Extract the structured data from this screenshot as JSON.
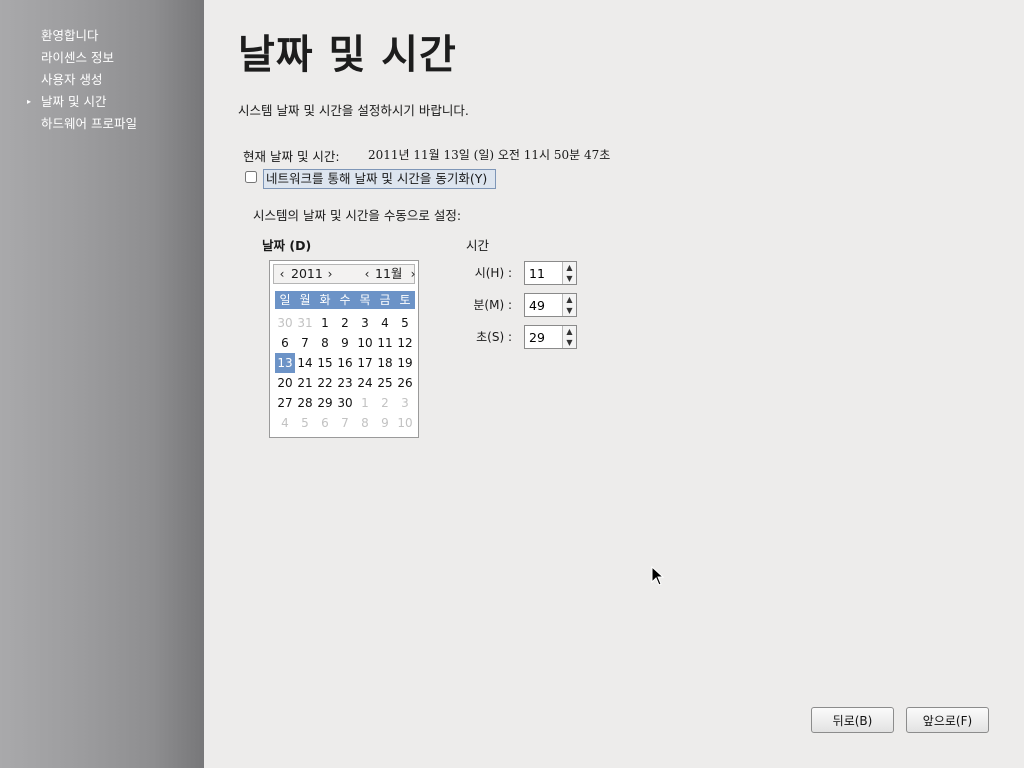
{
  "sidebar": {
    "items": [
      {
        "label": "환영합니다",
        "active": false
      },
      {
        "label": "라이센스 정보",
        "active": false
      },
      {
        "label": "사용자 생성",
        "active": false
      },
      {
        "label": "날짜 및 시간",
        "active": true
      },
      {
        "label": "하드웨어 프로파일",
        "active": false
      }
    ],
    "active_marker": "▸"
  },
  "main": {
    "title": "날짜 및 시간",
    "description": "시스템 날짜 및 시간을 설정하시기 바랍니다.",
    "current_label": "현재 날짜 및 시간:",
    "current_value": "2011년 11월 13일 (일) 오전 11시 50분 47초",
    "sync_label": "네트워크를 통해 날짜 및 시간을 동기화(Y)",
    "sync_checked": false,
    "manual_label": "시스템의 날짜 및 시간을 수동으로 설정:",
    "date_heading": "날짜 (D)",
    "time_heading": "시간"
  },
  "calendar": {
    "year": "2011",
    "month": "11월",
    "prev_glyph": "‹",
    "next_glyph": "›",
    "weekdays": [
      "일",
      "월",
      "화",
      "수",
      "목",
      "금",
      "토"
    ],
    "days": [
      {
        "d": "30",
        "other": true
      },
      {
        "d": "31",
        "other": true
      },
      {
        "d": "1"
      },
      {
        "d": "2"
      },
      {
        "d": "3"
      },
      {
        "d": "4"
      },
      {
        "d": "5"
      },
      {
        "d": "6"
      },
      {
        "d": "7"
      },
      {
        "d": "8"
      },
      {
        "d": "9"
      },
      {
        "d": "10"
      },
      {
        "d": "11"
      },
      {
        "d": "12"
      },
      {
        "d": "13",
        "selected": true
      },
      {
        "d": "14"
      },
      {
        "d": "15"
      },
      {
        "d": "16"
      },
      {
        "d": "17"
      },
      {
        "d": "18"
      },
      {
        "d": "19"
      },
      {
        "d": "20"
      },
      {
        "d": "21"
      },
      {
        "d": "22"
      },
      {
        "d": "23"
      },
      {
        "d": "24"
      },
      {
        "d": "25"
      },
      {
        "d": "26"
      },
      {
        "d": "27"
      },
      {
        "d": "28"
      },
      {
        "d": "29"
      },
      {
        "d": "30"
      },
      {
        "d": "1",
        "other": true
      },
      {
        "d": "2",
        "other": true
      },
      {
        "d": "3",
        "other": true
      },
      {
        "d": "4",
        "other": true
      },
      {
        "d": "5",
        "other": true
      },
      {
        "d": "6",
        "other": true
      },
      {
        "d": "7",
        "other": true
      },
      {
        "d": "8",
        "other": true
      },
      {
        "d": "9",
        "other": true
      },
      {
        "d": "10",
        "other": true
      }
    ]
  },
  "time": {
    "hour_label": "시(H) :",
    "hour_value": "11",
    "minute_label": "분(M) :",
    "minute_value": "49",
    "second_label": "초(S) :",
    "second_value": "29",
    "up_glyph": "▲",
    "down_glyph": "▼"
  },
  "buttons": {
    "back": "뒤로(B)",
    "forward": "앞으로(F)"
  },
  "colors": {
    "accent": "#6c93c7",
    "background": "#edeceb"
  }
}
